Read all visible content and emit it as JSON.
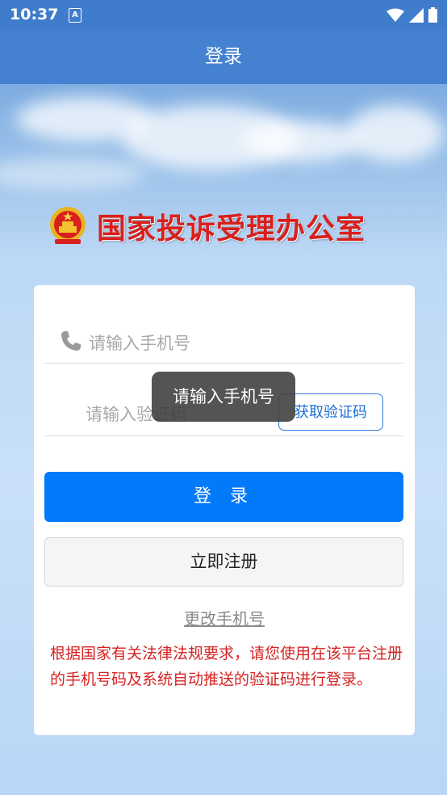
{
  "status_bar": {
    "time": "10:37",
    "notification_icon": "A",
    "icons": [
      "wifi-icon",
      "signal-icon",
      "battery-icon"
    ]
  },
  "app_bar": {
    "title": "登录"
  },
  "brand": {
    "name": "国家投诉受理办公室",
    "emblem": "national-emblem-icon"
  },
  "login_form": {
    "phone_placeholder": "请输入手机号",
    "code_placeholder": "请输入验证码",
    "get_code_label": "获取验证码",
    "login_label": "登 录",
    "register_label": "立即注册",
    "change_phone_label": "更改手机号",
    "notice": "根据国家有关法律法规要求，请您使用在该平台注册的手机号码及系统自动推送的验证码进行登录。"
  },
  "toast": {
    "message": "请输入手机号"
  },
  "colors": {
    "app_bar": "#4482d1",
    "primary_button": "#037af9",
    "brand_red": "#d8201d",
    "notice_red": "#d42323"
  }
}
